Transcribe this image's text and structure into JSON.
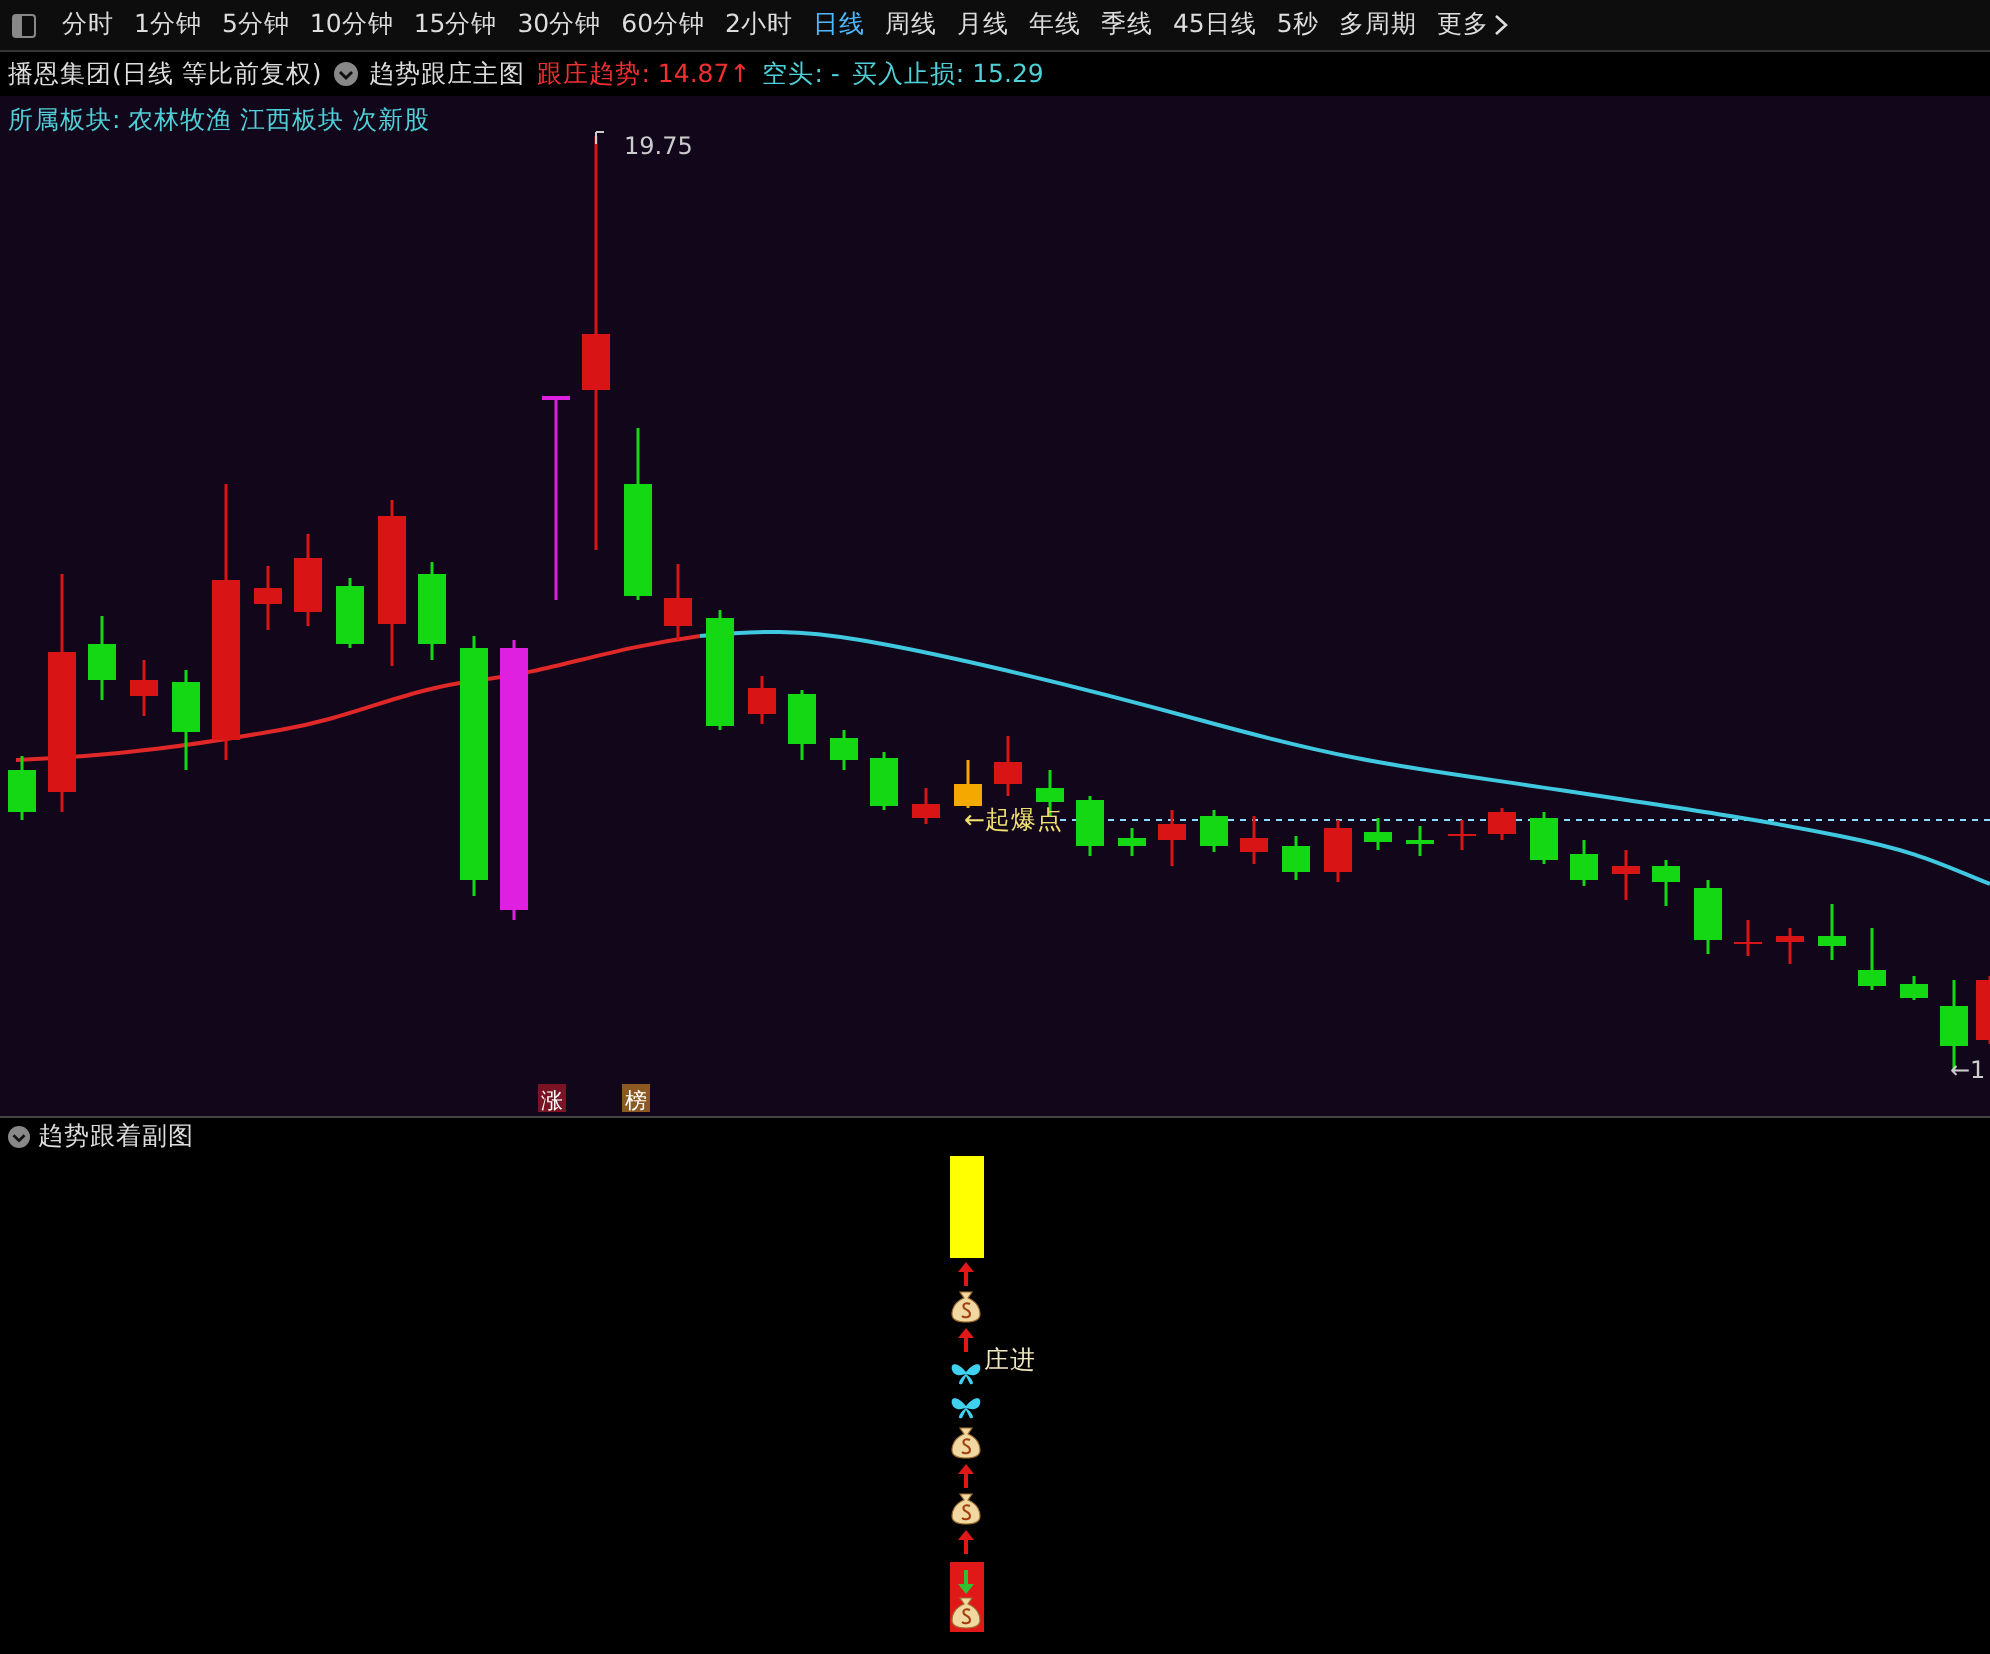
{
  "period_bar": {
    "items": [
      {
        "label": "分时",
        "selected": false
      },
      {
        "label": "1分钟",
        "selected": false
      },
      {
        "label": "5分钟",
        "selected": false
      },
      {
        "label": "10分钟",
        "selected": false
      },
      {
        "label": "15分钟",
        "selected": false
      },
      {
        "label": "30分钟",
        "selected": false
      },
      {
        "label": "60分钟",
        "selected": false
      },
      {
        "label": "2小时",
        "selected": false
      },
      {
        "label": "日线",
        "selected": true
      },
      {
        "label": "周线",
        "selected": false
      },
      {
        "label": "月线",
        "selected": false
      },
      {
        "label": "年线",
        "selected": false
      },
      {
        "label": "季线",
        "selected": false
      },
      {
        "label": "45日线",
        "selected": false
      },
      {
        "label": "5秒",
        "selected": false
      },
      {
        "label": "多周期",
        "selected": false
      }
    ],
    "more": "更多"
  },
  "header": {
    "stock": "播恩集团(日线 等比前复权)",
    "indicator": "趋势跟庄主图",
    "values": [
      {
        "label": "跟庄趋势: 14.87↑",
        "kind": "up"
      },
      {
        "label": "空头: -",
        "kind": "info"
      },
      {
        "label": "买入止损: 15.29",
        "kind": "info"
      }
    ]
  },
  "main_chart": {
    "sector": "所属板块: 农林牧渔 江西板块 次新股",
    "high_label": "19.75",
    "signal_label": "←起爆点",
    "edge_label": "←1",
    "markers": [
      {
        "text": "涨",
        "color": "#7a1424"
      },
      {
        "text": "榜",
        "color": "#8a5a22"
      }
    ]
  },
  "sub_chart": {
    "title": "趋势跟着副图",
    "signal_label": "庄进"
  }
}
